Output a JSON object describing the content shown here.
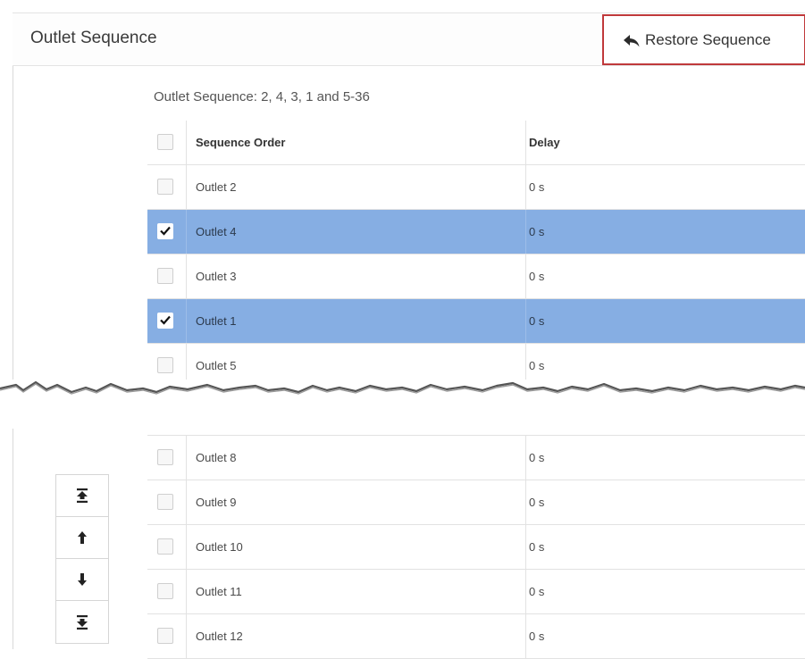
{
  "panel": {
    "title": "Outlet Sequence",
    "restore_button_label": "Restore Sequence",
    "restore_icon": "reply-arrow-icon"
  },
  "caption": "Outlet Sequence: 2, 4, 3, 1 and 5-36",
  "table": {
    "columns": [
      "Sequence Order",
      "Delay"
    ],
    "rows_top": [
      {
        "outlet": "Outlet 2",
        "delay": "0 s",
        "checked": false
      },
      {
        "outlet": "Outlet 4",
        "delay": "0 s",
        "checked": true
      },
      {
        "outlet": "Outlet 3",
        "delay": "0 s",
        "checked": false
      },
      {
        "outlet": "Outlet 1",
        "delay": "0 s",
        "checked": true
      },
      {
        "outlet": "Outlet 5",
        "delay": "0 s",
        "checked": false
      }
    ],
    "rows_bottom": [
      {
        "outlet": "Outlet 8",
        "delay": "0 s",
        "checked": false
      },
      {
        "outlet": "Outlet 9",
        "delay": "0 s",
        "checked": false
      },
      {
        "outlet": "Outlet 10",
        "delay": "0 s",
        "checked": false
      },
      {
        "outlet": "Outlet 11",
        "delay": "0 s",
        "checked": false
      },
      {
        "outlet": "Outlet 12",
        "delay": "0 s",
        "checked": false
      }
    ]
  },
  "move_controls": [
    "move-to-top-icon",
    "move-up-icon",
    "move-down-icon",
    "move-to-bottom-icon"
  ],
  "colors": {
    "selected_row": "#86aee3",
    "restore_border": "#c0393b"
  }
}
